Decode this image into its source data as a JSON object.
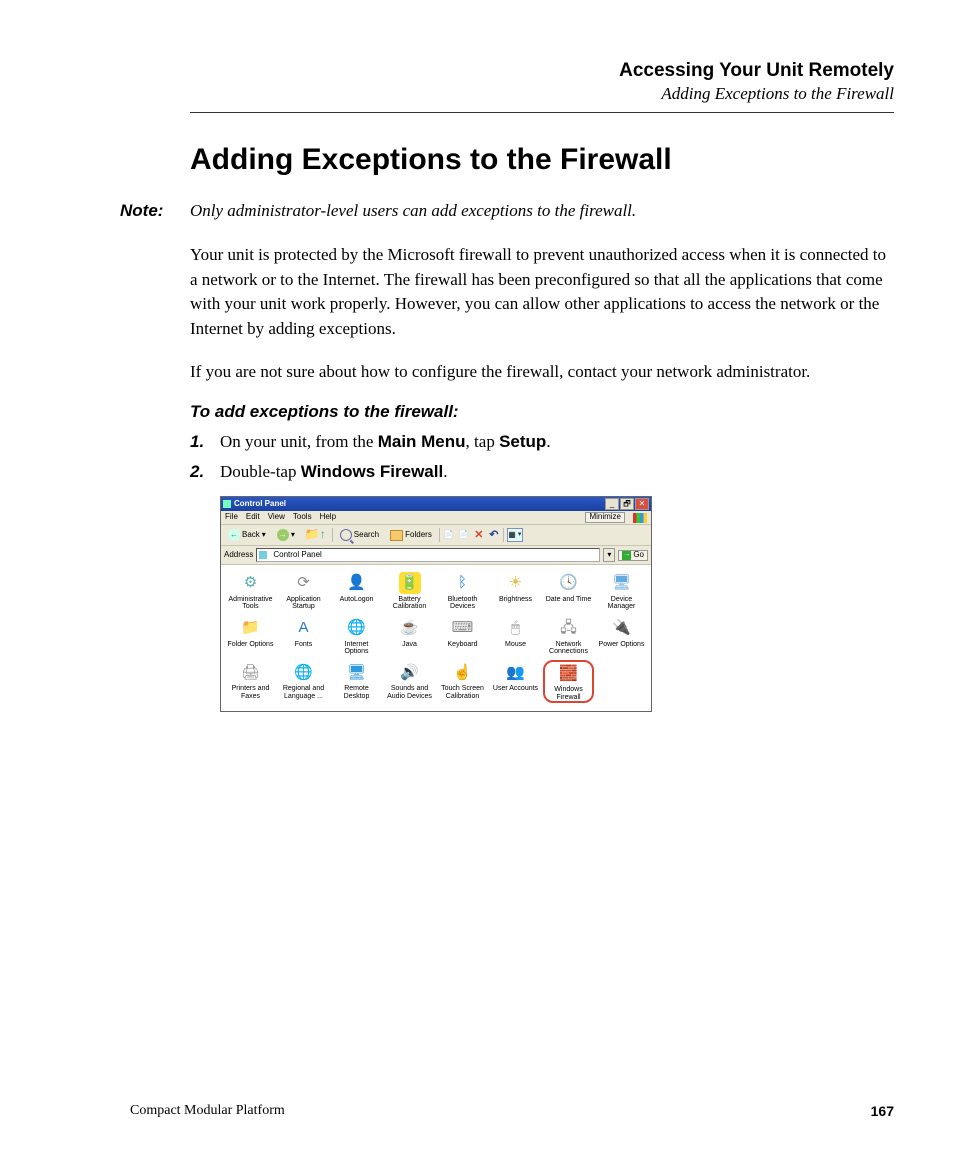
{
  "header": {
    "chapter": "Accessing Your Unit Remotely",
    "section": "Adding Exceptions to the Firewall"
  },
  "title": "Adding Exceptions to the Firewall",
  "note": {
    "label": "Note:",
    "text": "Only administrator-level users can add exceptions to the firewall."
  },
  "paragraphs": {
    "p1": "Your unit is protected by the Microsoft firewall to prevent unauthorized access when it is connected to a network or to the Internet. The firewall has been preconfigured so that all the applications that come with your unit work properly. However, you can allow other applications to access the network or the Internet by adding exceptions.",
    "p2": "If you are not sure about how to configure the firewall, contact your network administrator."
  },
  "procedure": {
    "title": "To add exceptions to the firewall:",
    "steps": {
      "s1": {
        "num": "1.",
        "pre": "On your unit, from the ",
        "b1": "Main Menu",
        "mid": ", tap ",
        "b2": "Setup",
        "post": "."
      },
      "s2": {
        "num": "2.",
        "pre": "Double-tap ",
        "b1": "Windows Firewall",
        "post": "."
      }
    }
  },
  "cp": {
    "title": "Control Panel",
    "minimize_label": "Minimize",
    "menus": {
      "file": "File",
      "edit": "Edit",
      "view": "View",
      "tools": "Tools",
      "help": "Help"
    },
    "toolbar": {
      "back": "Back",
      "search": "Search",
      "folders": "Folders"
    },
    "address": {
      "label": "Address",
      "value": "Control Panel",
      "go": "Go"
    },
    "items": [
      {
        "label": "Administrative Tools",
        "icon": "⚙",
        "cls": "ico-admin"
      },
      {
        "label": "Application Startup",
        "icon": "⟳",
        "cls": "ico-app"
      },
      {
        "label": "AutoLogon",
        "icon": "👤",
        "cls": "ico-auto"
      },
      {
        "label": "Battery Calibration",
        "icon": "🔋",
        "cls": "ico-batt"
      },
      {
        "label": "Bluetooth Devices",
        "icon": "ᛒ",
        "cls": "ico-bt"
      },
      {
        "label": "Brightness",
        "icon": "☀",
        "cls": "ico-bright"
      },
      {
        "label": "Date and Time",
        "icon": "🕓",
        "cls": "ico-date"
      },
      {
        "label": "Device Manager",
        "icon": "🖥",
        "cls": "ico-dev"
      },
      {
        "label": "Folder Options",
        "icon": "📁",
        "cls": "ico-folder"
      },
      {
        "label": "Fonts",
        "icon": "A",
        "cls": "ico-font"
      },
      {
        "label": "Internet Options",
        "icon": "🌐",
        "cls": "ico-ie"
      },
      {
        "label": "Java",
        "icon": "☕",
        "cls": "ico-java"
      },
      {
        "label": "Keyboard",
        "icon": "⌨",
        "cls": "ico-kb"
      },
      {
        "label": "Mouse",
        "icon": "🖱",
        "cls": "ico-mouse"
      },
      {
        "label": "Network Connections",
        "icon": "🖧",
        "cls": "ico-net"
      },
      {
        "label": "Power Options",
        "icon": "🔌",
        "cls": "ico-power"
      },
      {
        "label": "Printers and Faxes",
        "icon": "🖨",
        "cls": "ico-print"
      },
      {
        "label": "Regional and Language ...",
        "icon": "🌐",
        "cls": "ico-region"
      },
      {
        "label": "Remote Desktop",
        "icon": "🖥",
        "cls": "ico-rdp"
      },
      {
        "label": "Sounds and Audio Devices",
        "icon": "🔊",
        "cls": "ico-sound"
      },
      {
        "label": "Touch Screen Calibration",
        "icon": "☝",
        "cls": "ico-touch"
      },
      {
        "label": "User Accounts",
        "icon": "👥",
        "cls": "ico-user"
      },
      {
        "label": "Windows Firewall",
        "icon": "🧱",
        "cls": "ico-fw",
        "highlight": true
      }
    ]
  },
  "footer": {
    "left": "Compact Modular Platform",
    "right": "167"
  }
}
